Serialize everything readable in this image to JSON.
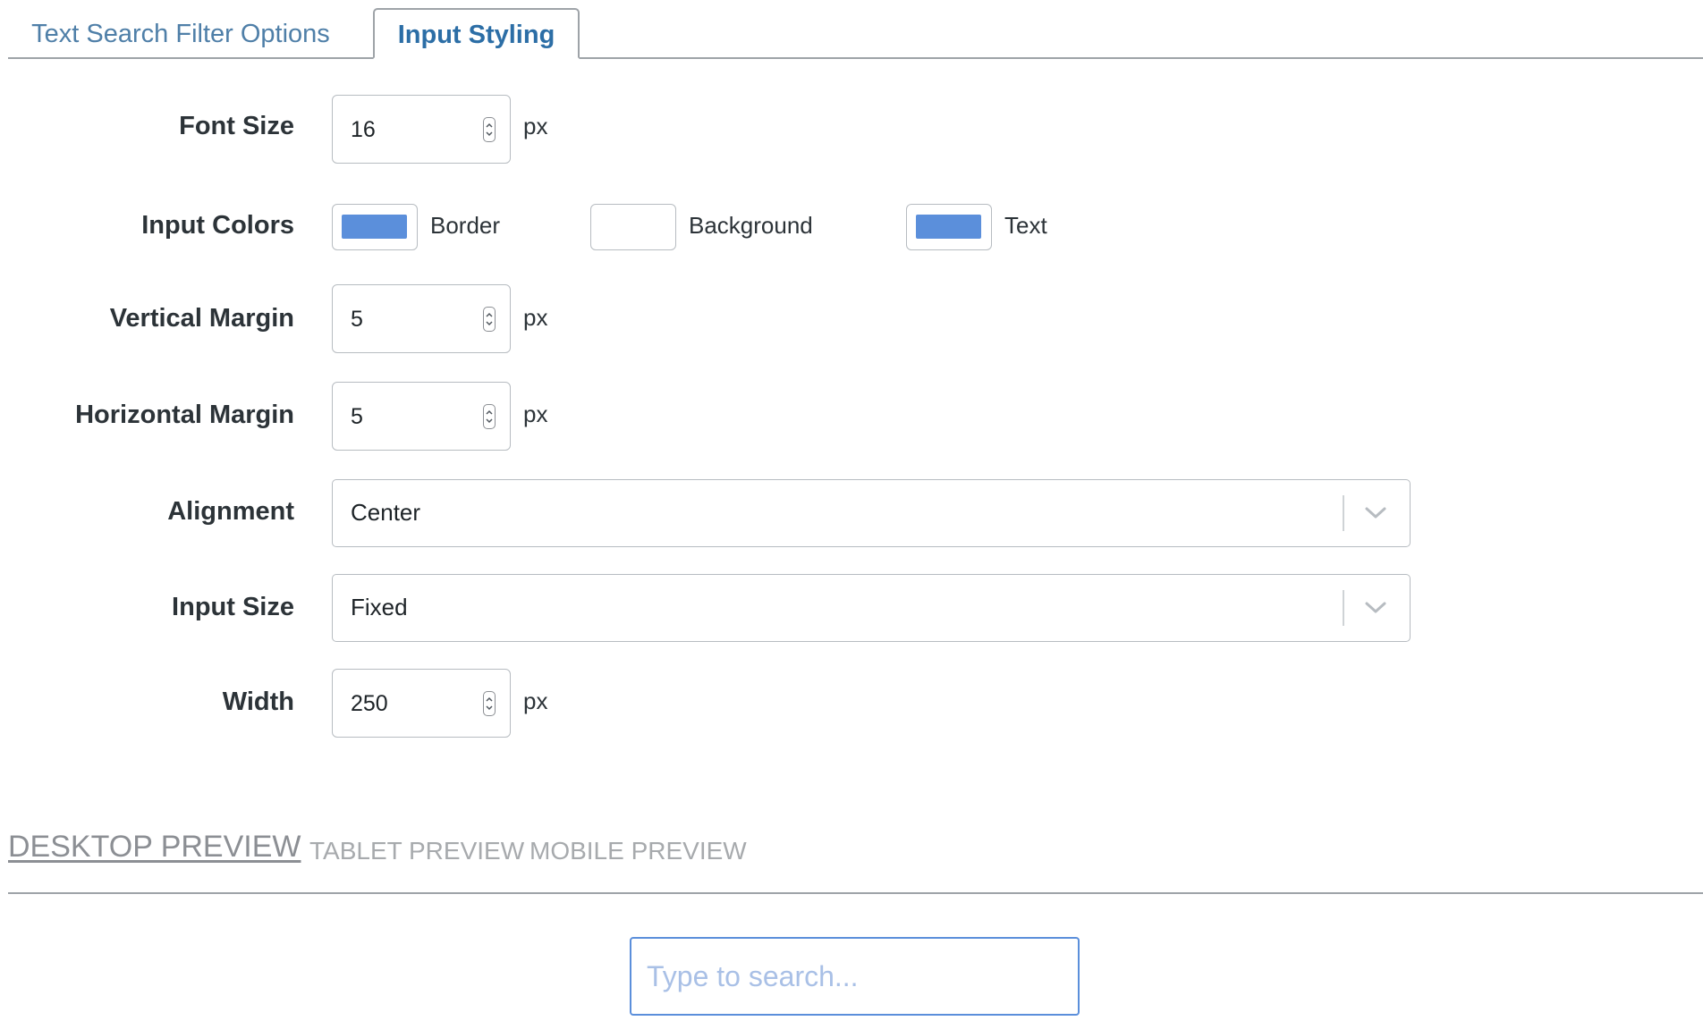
{
  "tabs": {
    "text_search": "Text Search Filter Options",
    "input_styling": "Input Styling"
  },
  "form": {
    "font_size": {
      "label": "Font Size",
      "value": "16",
      "unit": "px"
    },
    "input_colors": {
      "label": "Input Colors",
      "border": {
        "label": "Border",
        "color": "#5b8fdb"
      },
      "background": {
        "label": "Background",
        "color": "#ffffff"
      },
      "text": {
        "label": "Text",
        "color": "#5b8fdb"
      }
    },
    "vertical_margin": {
      "label": "Vertical Margin",
      "value": "5",
      "unit": "px"
    },
    "horizontal_margin": {
      "label": "Horizontal Margin",
      "value": "5",
      "unit": "px"
    },
    "alignment": {
      "label": "Alignment",
      "value": "Center"
    },
    "input_size": {
      "label": "Input Size",
      "value": "Fixed"
    },
    "width": {
      "label": "Width",
      "value": "250",
      "unit": "px"
    }
  },
  "preview": {
    "tabs": [
      "DESKTOP PREVIEW",
      "TABLET PREVIEW",
      "MOBILE PREVIEW"
    ],
    "active_tab": "DESKTOP PREVIEW",
    "search_placeholder": "Type to search..."
  }
}
